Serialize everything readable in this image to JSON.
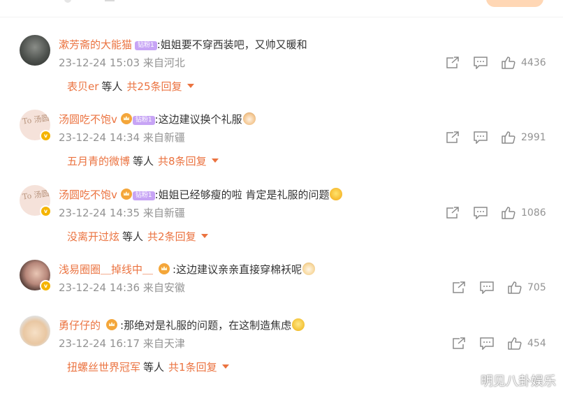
{
  "comments": [
    {
      "username": "漱芳斋的大能猫",
      "fan_badge": "钻粉1",
      "text": ":姐姐要不穿西装吧，又帅又暖和",
      "timestamp": "23-12-24 15:03",
      "location": "来自河北",
      "likes": "4436",
      "avatar": "panda-avatar",
      "reply_preview": {
        "name": "表贝er",
        "others": "等人",
        "count": "共25条回复"
      }
    },
    {
      "username": "汤圆吃不饱v",
      "fan_badge": "钻粉1",
      "text": ":这边建议换个礼服",
      "emoji": "cat-emoji",
      "timestamp": "23-12-24 14:34",
      "location": "来自新疆",
      "likes": "2991",
      "avatar": "tangyuan-avatar",
      "avatar_text": "To 汤圆",
      "reply_preview": {
        "name": "五月青的微博",
        "others": "等人",
        "count": "共8条回复"
      }
    },
    {
      "username": "汤圆吃不饱v",
      "fan_badge": "钻粉1",
      "text": ":姐姐已经够瘦的啦 肯定是礼服的问题",
      "emoji": "laugh-emoji",
      "timestamp": "23-12-24 14:35",
      "location": "来自新疆",
      "likes": "1086",
      "avatar": "tangyuan-avatar",
      "avatar_text": "To 汤圆",
      "reply_preview": {
        "name": "没离开过炫",
        "others": "等人",
        "count": "共2条回复"
      }
    },
    {
      "username": "浅易圈圈＿掉线中＿",
      "text": ":这边建议亲亲直接穿棉袄呢",
      "emoji": "dog-emoji",
      "timestamp": "23-12-24 14:36",
      "location": "来自安徽",
      "likes": "705",
      "avatar": "girl-avatar"
    },
    {
      "username": "勇仔仔的",
      "text": ":那绝对是礼服的问题，在这制造焦虑",
      "emoji": "worried-emoji",
      "timestamp": "23-12-24 16:17",
      "location": "来自天津",
      "likes": "454",
      "avatar": "baby-avatar",
      "reply_preview": {
        "name": "扭螺丝世界冠军",
        "others": "等人",
        "count": "共1条回复"
      }
    }
  ],
  "icons": {
    "share": "share-icon",
    "comment": "comment-icon",
    "like": "like-icon",
    "expand": "caret-down-icon",
    "crown": "crown-icon"
  },
  "colors": {
    "username": "#eb7340",
    "meta": "#939393",
    "badge": "#c7a4f5",
    "crown": "#f4a63a"
  },
  "watermark": "明见八卦娱乐"
}
